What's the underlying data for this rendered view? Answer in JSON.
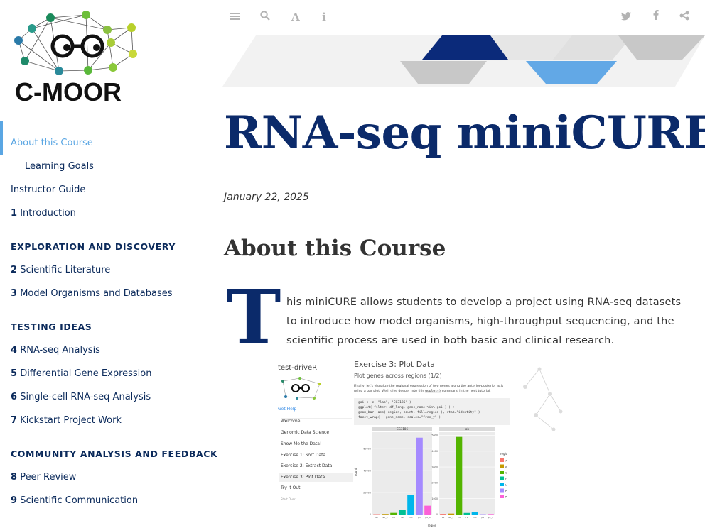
{
  "logo": {
    "text": "C-MOOR"
  },
  "sidebar": {
    "items": [
      {
        "num": "",
        "label": "About this Course",
        "active": true
      },
      {
        "num": "",
        "label": "Learning Goals",
        "indent": true
      },
      {
        "num": "",
        "label": "Instructor Guide"
      },
      {
        "num": "1",
        "label": "Introduction"
      }
    ],
    "sections": [
      {
        "title": "EXPLORATION AND DISCOVERY",
        "items": [
          {
            "num": "2",
            "label": "Scientific Literature"
          },
          {
            "num": "3",
            "label": "Model Organisms and Databases"
          }
        ]
      },
      {
        "title": "TESTING IDEAS",
        "items": [
          {
            "num": "4",
            "label": "RNA-seq Analysis"
          },
          {
            "num": "5",
            "label": "Differential Gene Expression"
          },
          {
            "num": "6",
            "label": "Single-cell RNA-seq Analysis"
          },
          {
            "num": "7",
            "label": "Kickstart Project Work"
          }
        ]
      },
      {
        "title": "COMMUNITY ANALYSIS AND FEEDBACK",
        "items": [
          {
            "num": "8",
            "label": "Peer Review"
          },
          {
            "num": "9",
            "label": "Scientific Communication"
          }
        ]
      }
    ]
  },
  "toolbar": {
    "icons": [
      "menu-icon",
      "search-icon",
      "font-icon",
      "info-icon",
      "twitter-icon",
      "facebook-icon",
      "share-icon"
    ],
    "font_glyph": "A",
    "info_glyph": "i"
  },
  "page": {
    "title": "RNA-seq miniCURE",
    "date": "January 22, 2025",
    "section_heading": "About this Course",
    "dropcap": "T",
    "intro": "his miniCURE allows students to develop a project using RNA-seq datasets to introduce how model organisms, high-throughput sequencing, and the scientific process are used in both basic and clinical research."
  },
  "figure": {
    "app_title": "test-driveR",
    "help": "Get Help",
    "links": [
      "Welcome",
      "Genomic Data Science",
      "Show Me the Data!",
      "Exercise 1: Sort Data",
      "Exercise 2: Extract Data",
      "Exercise 3: Plot Data",
      "Try it Out!",
      "Start Over"
    ],
    "exercise_title": "Exercise 3: Plot Data",
    "subtitle": "Plot genes across regions (1/2)",
    "desc1": "Finally, let's visualize the regional expression of two genes along the anterior-posterior axis",
    "desc2": "using a bar plot. We'll dive deeper into this",
    "desc_code": "ggplot()",
    "desc3": "command in the next tutorial.",
    "code": [
      "goi <- c( \"lab\", \"CG3186\" )",
      "ggplot( filter( df_long, gene_name %in% goi ) ) +",
      "    geom_bar( aes( region, count, fill=region ), stat=\"identity\" ) +",
      "    facet_wrap( ~ gene_name, scales=\"free_y\" )"
    ],
    "facet_labels": [
      "CG3186",
      "lab"
    ],
    "y_label": "count",
    "x_label": "region",
    "legend_title": "regio",
    "left_ticks": [
      "60000",
      "40000",
      "20000",
      "0"
    ],
    "right_ticks": [
      "5000",
      "4000",
      "3000",
      "2000",
      "1000",
      "0"
    ],
    "x_ticks": [
      "a1",
      "a2_3",
      "Cu",
      "Fe",
      "LFC",
      "Fe",
      "p1",
      "p2_4"
    ],
    "legend_letters": [
      "A",
      "A",
      "C",
      "F",
      "L",
      "P",
      "P"
    ]
  },
  "colors": {
    "accent_navy": "#0b2a6a",
    "accent_blue": "#5aa6e3",
    "bar_palette": [
      "#f8766d",
      "#c49a00",
      "#53b400",
      "#00c094",
      "#00b6eb",
      "#a58aff",
      "#fb61d7"
    ]
  },
  "chart_data": [
    {
      "type": "bar",
      "title": "CG3186",
      "categories": [
        "a1",
        "a2_3",
        "Cu",
        "Fe",
        "LFC",
        "p1",
        "p2_4"
      ],
      "values": [
        300,
        500,
        1500,
        4500,
        18000,
        70000,
        8000
      ],
      "ylim": [
        0,
        75000
      ],
      "xlabel": "region",
      "ylabel": "count"
    },
    {
      "type": "bar",
      "title": "lab",
      "categories": [
        "a1",
        "a2_3",
        "Cu",
        "Fe",
        "LFC",
        "p1",
        "p2_4"
      ],
      "values": [
        40,
        60,
        4900,
        100,
        150,
        20,
        30
      ],
      "ylim": [
        0,
        5200
      ],
      "xlabel": "region",
      "ylabel": "count"
    }
  ]
}
